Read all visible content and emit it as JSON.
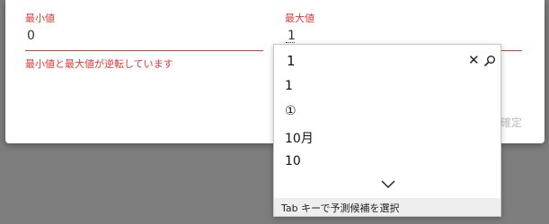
{
  "dialog": {
    "min_field": {
      "label": "最小値",
      "value": "0"
    },
    "max_field": {
      "label": "最大値",
      "value": "1"
    },
    "error_message": "最小値と最大値が逆転しています",
    "confirm_label": "確定"
  },
  "ime": {
    "input_text": "1",
    "close_icon": "close-icon",
    "search_icon": "search-icon",
    "candidates": [
      "1",
      "①",
      "10月",
      "10"
    ],
    "more_icon": "chevron-down-icon",
    "footer_hint": "Tab キーで予測候補を選択"
  },
  "colors": {
    "error": "#e53935",
    "overlay": "#7d7d7d",
    "disabled_text": "#bdbdbd"
  }
}
